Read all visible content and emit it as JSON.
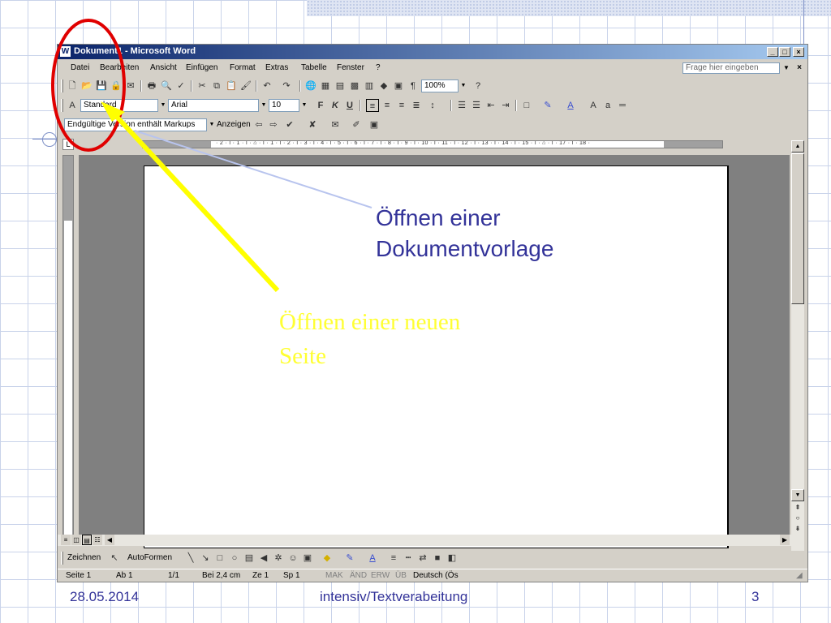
{
  "window": {
    "title": "Dokument1 - Microsoft Word",
    "app_icon": "W",
    "minimize": "_",
    "maximize": "□",
    "close": "×"
  },
  "menu": {
    "items": [
      "Datei",
      "Bearbeiten",
      "Ansicht",
      "Einfügen",
      "Format",
      "Extras",
      "Tabelle",
      "Fenster",
      "?"
    ],
    "help_placeholder": "Frage hier eingeben",
    "help_drop": "▼",
    "close_doc": "×"
  },
  "standard_toolbar": {
    "icons": [
      "new-document-icon",
      "open-icon",
      "save-icon",
      "permission-icon",
      "email-icon",
      "print-icon",
      "print-preview-icon",
      "spelling-icon",
      "cut-icon",
      "copy-icon",
      "paste-icon",
      "format-painter-icon",
      "undo-icon",
      "redo-icon",
      "hyperlink-icon",
      "tables-borders-icon",
      "insert-table-icon",
      "insert-excel-icon",
      "columns-icon",
      "drawing-icon",
      "document-map-icon",
      "show-hide-icon"
    ],
    "zoom": "100%",
    "help_icon": "?"
  },
  "formatting_toolbar": {
    "style": "Standard",
    "font": "Arial",
    "size": "10",
    "bold": "F",
    "italic": "K",
    "underline": "U"
  },
  "reviewing_toolbar": {
    "display": "Endgültige Version enthält Markups",
    "show": "Anzeigen"
  },
  "ruler": {
    "ticks": "· 2 · ı · 1 · ı · ⌂ · ı · 1 · ı · 2 · ı · 3 · ı · 4 · ı · 5 · ı · 6 · ı · 7 · ı · 8 · ı · 9 · ı · 10 · ı · 11 · ı · 12 · ı · 13 · ı · 14 · ı · 15 · ı · ⌂ · ı · 17 · ı · 18 ·",
    "tab_selector": "L"
  },
  "drawing_toolbar": {
    "draw": "Zeichnen",
    "autoshapes": "AutoFormen"
  },
  "status": {
    "page": "Seite 1",
    "section": "Ab 1",
    "pages": "1/1",
    "position": "Bei 2,4 cm",
    "line": "Ze 1",
    "column": "Sp 1",
    "mak": "MAK",
    "and": "ÄND",
    "erw": "ERW",
    "ub": "ÜB",
    "language": "Deutsch (Ös"
  },
  "annotations": {
    "template_line1": "Öffnen einer",
    "template_line2": "Dokumentvorlage",
    "newpage_line1": "Öffnen einer neuen",
    "newpage_line2": "Seite",
    "colors": {
      "template_text": "#333399",
      "newpage_text": "#ffff33",
      "circle": "#e00000",
      "arrow_yellow": "#ffff00",
      "arrow_blue": "#b8c4ee"
    }
  },
  "footer": {
    "date": "28.05.2014",
    "title": "intensiv/Textverabeitung",
    "page": "3"
  }
}
